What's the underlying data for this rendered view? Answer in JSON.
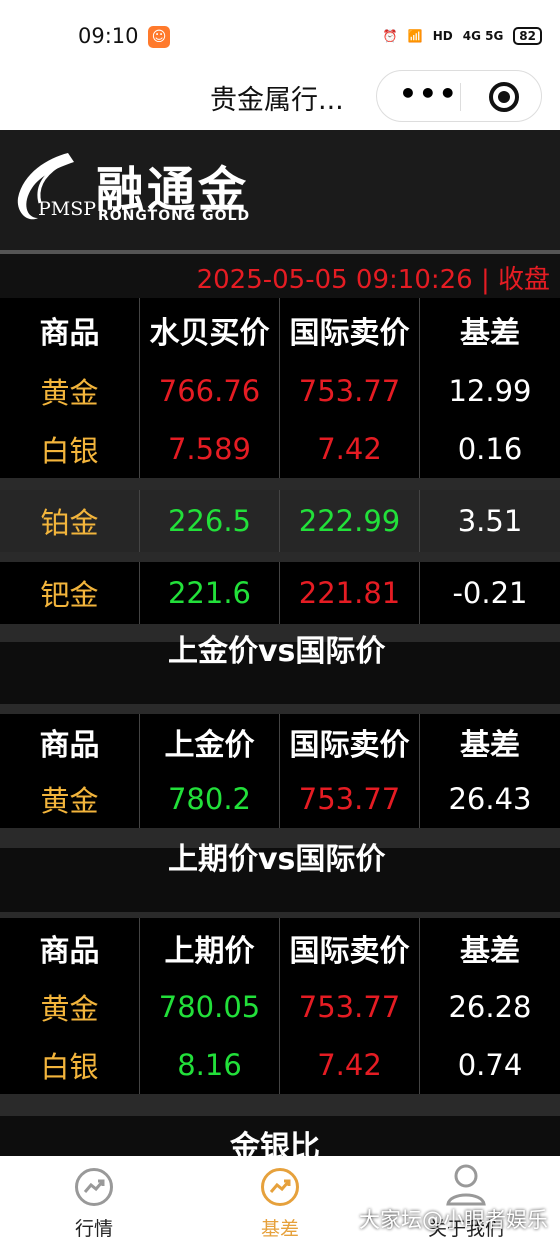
{
  "status": {
    "time": "09:10",
    "battery": "82",
    "signal": "4G 5G"
  },
  "titlebar": {
    "title": "贵金属行..."
  },
  "logo": {
    "cn": "融通金",
    "en": "RONGTONG  GOLD",
    "pmsp": "PMSP"
  },
  "datebar": {
    "text": "2025-05-05 09:10:26 | 收盘"
  },
  "table1": {
    "headers": [
      "商品",
      "水贝买价",
      "国际卖价",
      "基差"
    ],
    "rows": [
      [
        "黄金",
        "766.76",
        "753.77",
        "12.99"
      ],
      [
        "白银",
        "7.589",
        "7.42",
        "0.16"
      ],
      [
        "铂金",
        "226.5",
        "222.99",
        "3.51"
      ],
      [
        "钯金",
        "221.6",
        "221.81",
        "-0.21"
      ]
    ]
  },
  "section2": {
    "title": "上金价vs国际价"
  },
  "table2": {
    "headers": [
      "商品",
      "上金价",
      "国际卖价",
      "基差"
    ],
    "rows": [
      [
        "黄金",
        "780.2",
        "753.77",
        "26.43"
      ]
    ]
  },
  "section3": {
    "title": "上期价vs国际价"
  },
  "table3": {
    "headers": [
      "商品",
      "上期价",
      "国际卖价",
      "基差"
    ],
    "rows": [
      [
        "黄金",
        "780.05",
        "753.77",
        "26.28"
      ],
      [
        "白银",
        "8.16",
        "7.42",
        "0.74"
      ]
    ]
  },
  "section4": {
    "title": "金银比"
  },
  "tabbar": {
    "items": [
      "行情",
      "基差",
      "关于我们"
    ]
  },
  "watermark": "大家坛@小眼者娱乐"
}
